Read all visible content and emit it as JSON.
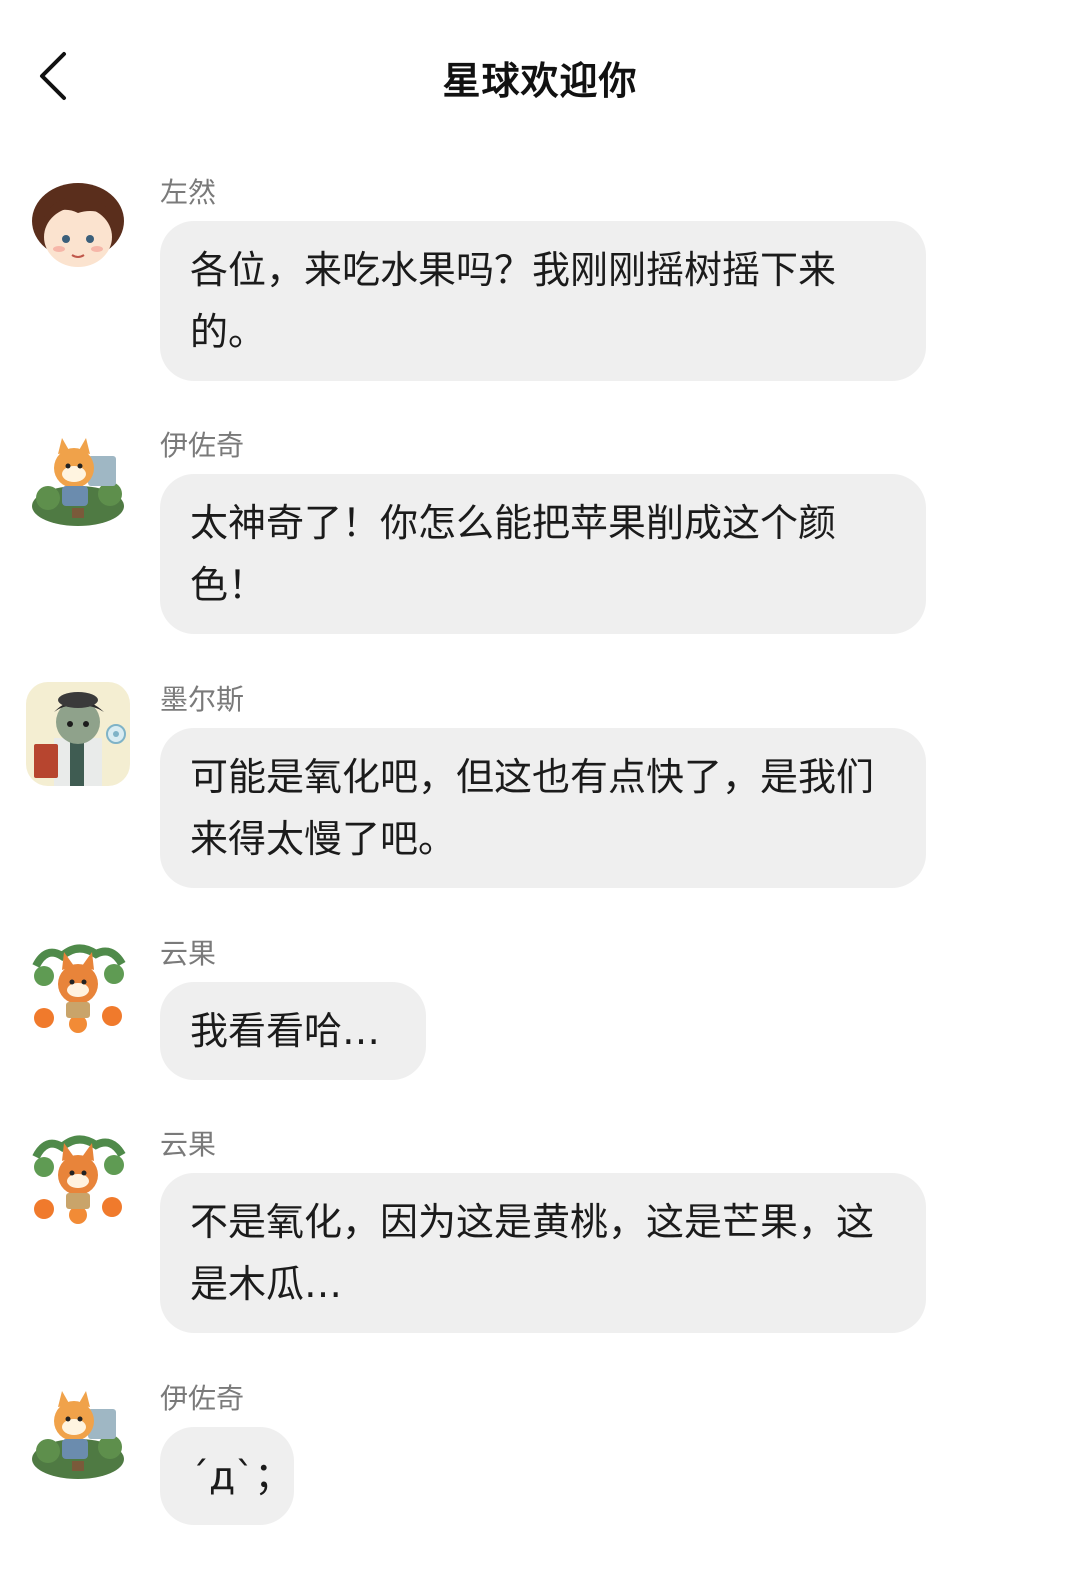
{
  "header": {
    "title": "星球欢迎你"
  },
  "messages": [
    {
      "sender": "左然",
      "text": "各位，来吃水果吗？我刚刚摇树摇下来的。"
    },
    {
      "sender": "伊佐奇",
      "text": "太神奇了！你怎么能把苹果削成这个颜色！"
    },
    {
      "sender": "墨尔斯",
      "text": "可能是氧化吧，但这也有点快了，是我们来得太慢了吧。"
    },
    {
      "sender": "云果",
      "text": "我看看哈…"
    },
    {
      "sender": "云果",
      "text": "不是氧化，因为这是黄桃，这是芒果，这是木瓜…"
    },
    {
      "sender": "伊佐奇",
      "text": "´д`；"
    }
  ],
  "icons": {
    "back": "chevron-left-icon"
  },
  "colors": {
    "bubble": "#efefef",
    "sender": "#7a7a7a",
    "text": "#1b1b1b"
  }
}
